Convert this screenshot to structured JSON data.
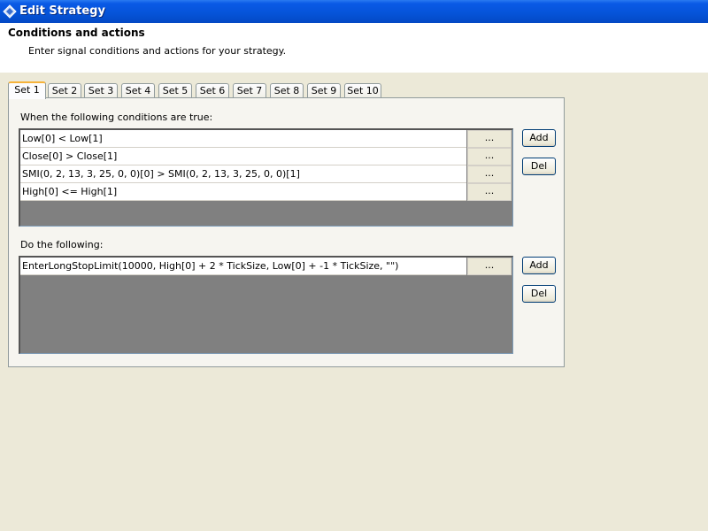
{
  "window": {
    "title": "Edit Strategy"
  },
  "header": {
    "heading": "Conditions and actions",
    "subtitle": "Enter signal conditions and actions for your strategy."
  },
  "tabs": [
    {
      "label": "Set 1",
      "active": true
    },
    {
      "label": "Set 2"
    },
    {
      "label": "Set 3"
    },
    {
      "label": "Set 4"
    },
    {
      "label": "Set 5"
    },
    {
      "label": "Set 6"
    },
    {
      "label": "Set 7"
    },
    {
      "label": "Set 8"
    },
    {
      "label": "Set 9"
    },
    {
      "label": "Set 10"
    }
  ],
  "conditions": {
    "label": "When the following conditions are true:",
    "rows": [
      {
        "text": "Low[0] < Low[1]",
        "button": "..."
      },
      {
        "text": "Close[0] > Close[1]",
        "button": "..."
      },
      {
        "text": "SMI(0, 2, 13, 3, 25, 0, 0)[0] > SMI(0, 2, 13, 3, 25, 0, 0)[1]",
        "button": "..."
      },
      {
        "text": "High[0] <= High[1]",
        "button": "..."
      }
    ],
    "add_label": "Add",
    "del_label": "Del"
  },
  "actions": {
    "label": "Do the following:",
    "rows": [
      {
        "text": "EnterLongStopLimit(10000, High[0] + 2 * TickSize, Low[0] + -1 * TickSize, \"\")",
        "button": "..."
      }
    ],
    "add_label": "Add",
    "del_label": "Del"
  }
}
